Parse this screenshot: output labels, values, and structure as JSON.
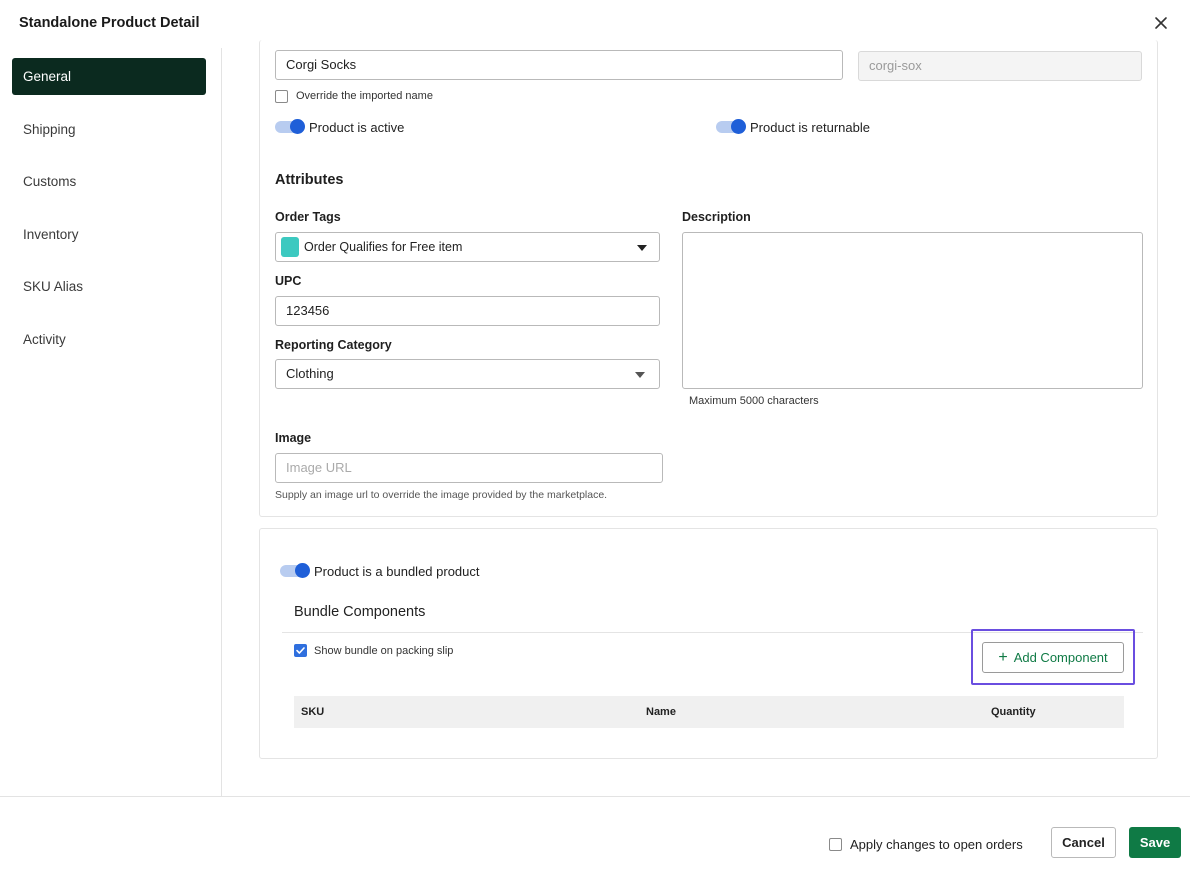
{
  "header": {
    "title": "Standalone Product Detail",
    "close_icon": "close-icon"
  },
  "sidebar": {
    "items": [
      {
        "label": "General",
        "active": true
      },
      {
        "label": "Shipping"
      },
      {
        "label": "Customs"
      },
      {
        "label": "Inventory"
      },
      {
        "label": "SKU Alias"
      },
      {
        "label": "Activity"
      }
    ]
  },
  "general": {
    "name_value": "Corgi Socks",
    "sku_value": "corgi-sox",
    "override_label": "Override the imported name",
    "active_label": "Product is active",
    "returnable_label": "Product is returnable",
    "attributes_title": "Attributes",
    "order_tags_label": "Order Tags",
    "order_tags_value": "Order Qualifies for Free item",
    "order_tag_color": "#3cc9c0",
    "upc_label": "UPC",
    "upc_value": "123456",
    "reporting_category_label": "Reporting Category",
    "reporting_category_value": "Clothing",
    "description_label": "Description",
    "description_hint": "Maximum 5000 characters",
    "image_label": "Image",
    "image_placeholder": "Image URL",
    "image_hint": "Supply an image url to override the image provided by the marketplace."
  },
  "bundle": {
    "toggle_label": "Product is a bundled product",
    "title": "Bundle Components",
    "show_on_slip_label": "Show bundle on packing slip",
    "add_component_label": "Add Component",
    "table_headers": {
      "sku": "SKU",
      "name": "Name",
      "quantity": "Quantity"
    }
  },
  "footer": {
    "apply_label": "Apply changes to open orders",
    "cancel_label": "Cancel",
    "save_label": "Save"
  },
  "colors": {
    "accent_green": "#0f7a45",
    "nav_active": "#0b2a1f",
    "toggle_blue": "#1f5fd8",
    "highlight": "#6a4ee0"
  }
}
